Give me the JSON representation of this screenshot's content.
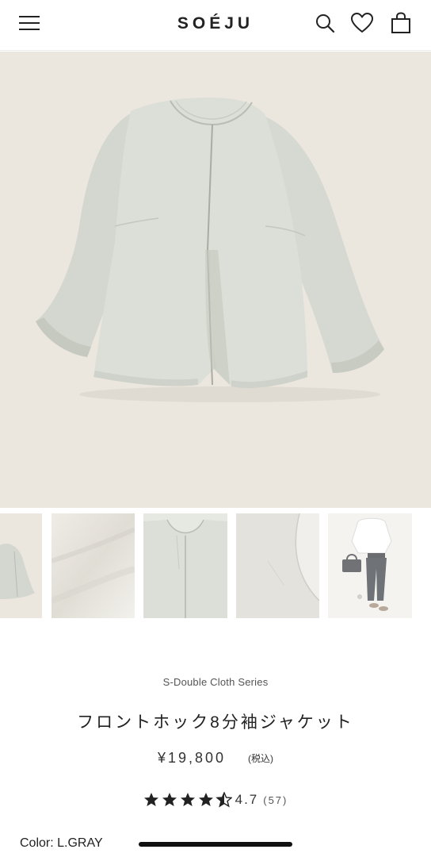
{
  "header": {
    "logo": "SOÉJU",
    "icons": [
      "menu-icon",
      "search-icon",
      "heart-icon",
      "bag-icon"
    ]
  },
  "product": {
    "series": "S-Double Cloth Series",
    "name": "フロントホック8分袖ジャケット",
    "price": "¥19,800",
    "tax_note": "(税込)",
    "rating": 4.7,
    "rating_label": "4.7",
    "review_count": "(57)",
    "color_label": "Color: L.GRAY"
  },
  "gallery": {
    "thumbnails": [
      "jacket-front",
      "fabric-closeup",
      "neckline-detail",
      "sleeve-detail",
      "styling-outfit"
    ]
  },
  "colors": {
    "hero_bg": "#ebe7df",
    "jacket": "#d9dcd4",
    "text": "#222222"
  }
}
